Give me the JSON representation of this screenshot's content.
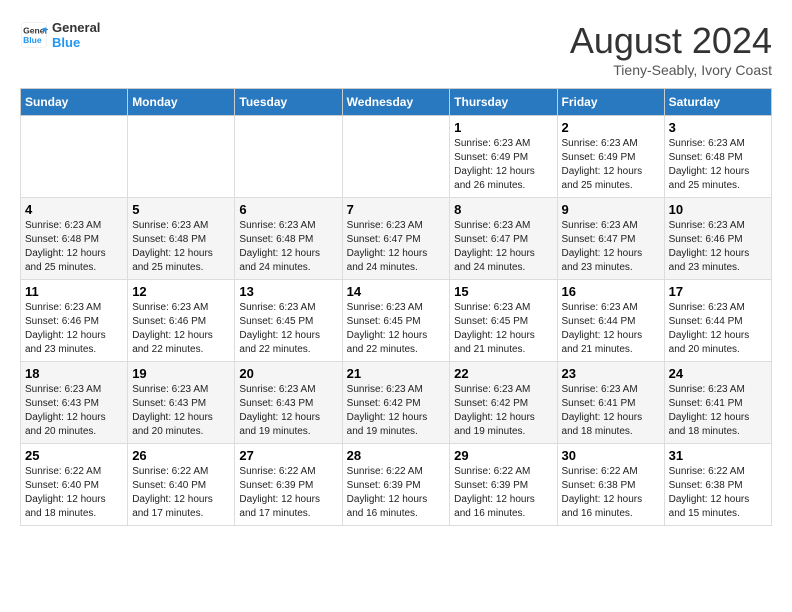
{
  "header": {
    "logo_line1": "General",
    "logo_line2": "Blue",
    "month": "August 2024",
    "location": "Tieny-Seably, Ivory Coast"
  },
  "days_of_week": [
    "Sunday",
    "Monday",
    "Tuesday",
    "Wednesday",
    "Thursday",
    "Friday",
    "Saturday"
  ],
  "weeks": [
    [
      {
        "num": "",
        "info": ""
      },
      {
        "num": "",
        "info": ""
      },
      {
        "num": "",
        "info": ""
      },
      {
        "num": "",
        "info": ""
      },
      {
        "num": "1",
        "info": "Sunrise: 6:23 AM\nSunset: 6:49 PM\nDaylight: 12 hours\nand 26 minutes."
      },
      {
        "num": "2",
        "info": "Sunrise: 6:23 AM\nSunset: 6:49 PM\nDaylight: 12 hours\nand 25 minutes."
      },
      {
        "num": "3",
        "info": "Sunrise: 6:23 AM\nSunset: 6:48 PM\nDaylight: 12 hours\nand 25 minutes."
      }
    ],
    [
      {
        "num": "4",
        "info": "Sunrise: 6:23 AM\nSunset: 6:48 PM\nDaylight: 12 hours\nand 25 minutes."
      },
      {
        "num": "5",
        "info": "Sunrise: 6:23 AM\nSunset: 6:48 PM\nDaylight: 12 hours\nand 25 minutes."
      },
      {
        "num": "6",
        "info": "Sunrise: 6:23 AM\nSunset: 6:48 PM\nDaylight: 12 hours\nand 24 minutes."
      },
      {
        "num": "7",
        "info": "Sunrise: 6:23 AM\nSunset: 6:47 PM\nDaylight: 12 hours\nand 24 minutes."
      },
      {
        "num": "8",
        "info": "Sunrise: 6:23 AM\nSunset: 6:47 PM\nDaylight: 12 hours\nand 24 minutes."
      },
      {
        "num": "9",
        "info": "Sunrise: 6:23 AM\nSunset: 6:47 PM\nDaylight: 12 hours\nand 23 minutes."
      },
      {
        "num": "10",
        "info": "Sunrise: 6:23 AM\nSunset: 6:46 PM\nDaylight: 12 hours\nand 23 minutes."
      }
    ],
    [
      {
        "num": "11",
        "info": "Sunrise: 6:23 AM\nSunset: 6:46 PM\nDaylight: 12 hours\nand 23 minutes."
      },
      {
        "num": "12",
        "info": "Sunrise: 6:23 AM\nSunset: 6:46 PM\nDaylight: 12 hours\nand 22 minutes."
      },
      {
        "num": "13",
        "info": "Sunrise: 6:23 AM\nSunset: 6:45 PM\nDaylight: 12 hours\nand 22 minutes."
      },
      {
        "num": "14",
        "info": "Sunrise: 6:23 AM\nSunset: 6:45 PM\nDaylight: 12 hours\nand 22 minutes."
      },
      {
        "num": "15",
        "info": "Sunrise: 6:23 AM\nSunset: 6:45 PM\nDaylight: 12 hours\nand 21 minutes."
      },
      {
        "num": "16",
        "info": "Sunrise: 6:23 AM\nSunset: 6:44 PM\nDaylight: 12 hours\nand 21 minutes."
      },
      {
        "num": "17",
        "info": "Sunrise: 6:23 AM\nSunset: 6:44 PM\nDaylight: 12 hours\nand 20 minutes."
      }
    ],
    [
      {
        "num": "18",
        "info": "Sunrise: 6:23 AM\nSunset: 6:43 PM\nDaylight: 12 hours\nand 20 minutes."
      },
      {
        "num": "19",
        "info": "Sunrise: 6:23 AM\nSunset: 6:43 PM\nDaylight: 12 hours\nand 20 minutes."
      },
      {
        "num": "20",
        "info": "Sunrise: 6:23 AM\nSunset: 6:43 PM\nDaylight: 12 hours\nand 19 minutes."
      },
      {
        "num": "21",
        "info": "Sunrise: 6:23 AM\nSunset: 6:42 PM\nDaylight: 12 hours\nand 19 minutes."
      },
      {
        "num": "22",
        "info": "Sunrise: 6:23 AM\nSunset: 6:42 PM\nDaylight: 12 hours\nand 19 minutes."
      },
      {
        "num": "23",
        "info": "Sunrise: 6:23 AM\nSunset: 6:41 PM\nDaylight: 12 hours\nand 18 minutes."
      },
      {
        "num": "24",
        "info": "Sunrise: 6:23 AM\nSunset: 6:41 PM\nDaylight: 12 hours\nand 18 minutes."
      }
    ],
    [
      {
        "num": "25",
        "info": "Sunrise: 6:22 AM\nSunset: 6:40 PM\nDaylight: 12 hours\nand 18 minutes."
      },
      {
        "num": "26",
        "info": "Sunrise: 6:22 AM\nSunset: 6:40 PM\nDaylight: 12 hours\nand 17 minutes."
      },
      {
        "num": "27",
        "info": "Sunrise: 6:22 AM\nSunset: 6:39 PM\nDaylight: 12 hours\nand 17 minutes."
      },
      {
        "num": "28",
        "info": "Sunrise: 6:22 AM\nSunset: 6:39 PM\nDaylight: 12 hours\nand 16 minutes."
      },
      {
        "num": "29",
        "info": "Sunrise: 6:22 AM\nSunset: 6:39 PM\nDaylight: 12 hours\nand 16 minutes."
      },
      {
        "num": "30",
        "info": "Sunrise: 6:22 AM\nSunset: 6:38 PM\nDaylight: 12 hours\nand 16 minutes."
      },
      {
        "num": "31",
        "info": "Sunrise: 6:22 AM\nSunset: 6:38 PM\nDaylight: 12 hours\nand 15 minutes."
      }
    ]
  ]
}
